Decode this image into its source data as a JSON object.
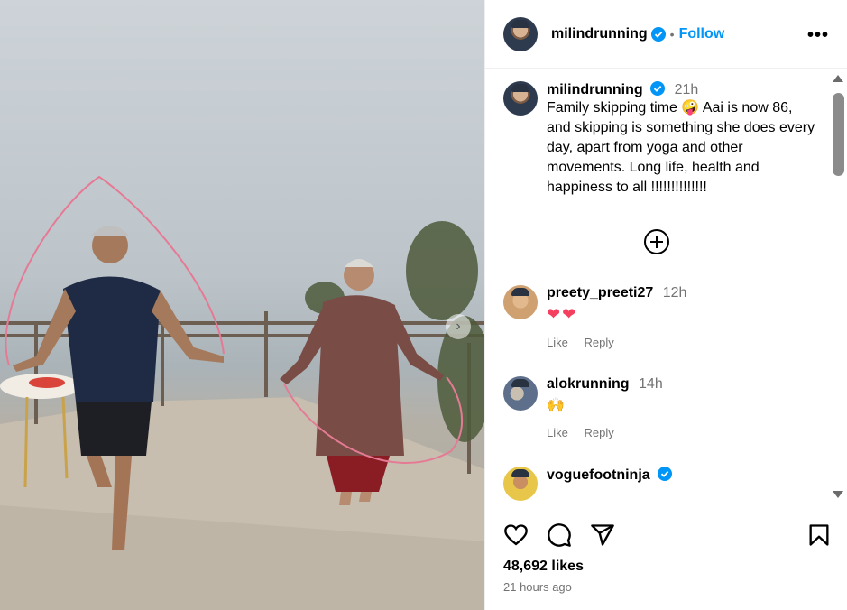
{
  "post": {
    "username": "milindrunning",
    "separator": "•",
    "follow_label": "Follow",
    "more_label": "•••"
  },
  "caption": {
    "username": "milindrunning",
    "time": "21h",
    "text": "Family skipping time 🤪 Aai is now 86, and skipping is something she does every day, apart from yoga and other movements. Long life, health and happiness to all !!!!!!!!!!!!!!"
  },
  "comments": [
    {
      "username": "preety_preeti27",
      "time": "12h",
      "text": "❤❤",
      "like_label": "Like",
      "reply_label": "Reply"
    },
    {
      "username": "alokrunning",
      "time": "14h",
      "text": "🙌",
      "like_label": "Like",
      "reply_label": "Reply"
    },
    {
      "username": "voguefootninja",
      "time": "",
      "text": "",
      "like_label": "",
      "reply_label": ""
    }
  ],
  "footer": {
    "likes": "48,692 likes",
    "time_ago": "21 hours ago"
  },
  "colors": {
    "accent": "#0095f6",
    "secondary_text": "#737373",
    "divider": "#efefef"
  },
  "icons": [
    "verified-icon",
    "more-options-icon",
    "load-more-icon",
    "like-icon",
    "comment-icon",
    "share-icon",
    "save-icon",
    "next-media-icon"
  ]
}
